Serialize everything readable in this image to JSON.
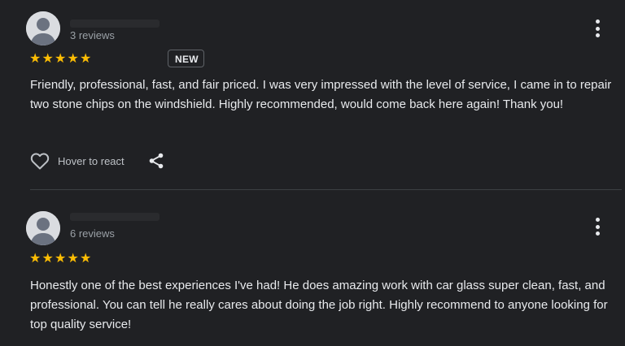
{
  "reviews": [
    {
      "review_count": "3 reviews",
      "rating": 5,
      "stars": "★★★★★",
      "badge": "NEW",
      "text": "Friendly, professional, fast, and fair priced. I was very impressed with the level of service, I came in to repair two stone chips on the windshield. Highly recommended, would come back here again! Thank you!",
      "react_label": "Hover to react"
    },
    {
      "review_count": "6 reviews",
      "rating": 5,
      "stars": "★★★★★",
      "text": "Honestly one of the best experiences I've had! He does amazing work with car glass super clean, fast, and professional. You can tell he really cares about doing the job right. Highly recommend to anyone looking for top quality service!"
    }
  ],
  "colors": {
    "background": "#202124",
    "star": "#fbbc04",
    "text": "#e8eaed",
    "muted": "#9aa0a6"
  },
  "icons": {
    "avatar": "person-silhouette-icon",
    "more": "more-vert-icon",
    "react": "heart-outline-icon",
    "share": "share-icon"
  }
}
